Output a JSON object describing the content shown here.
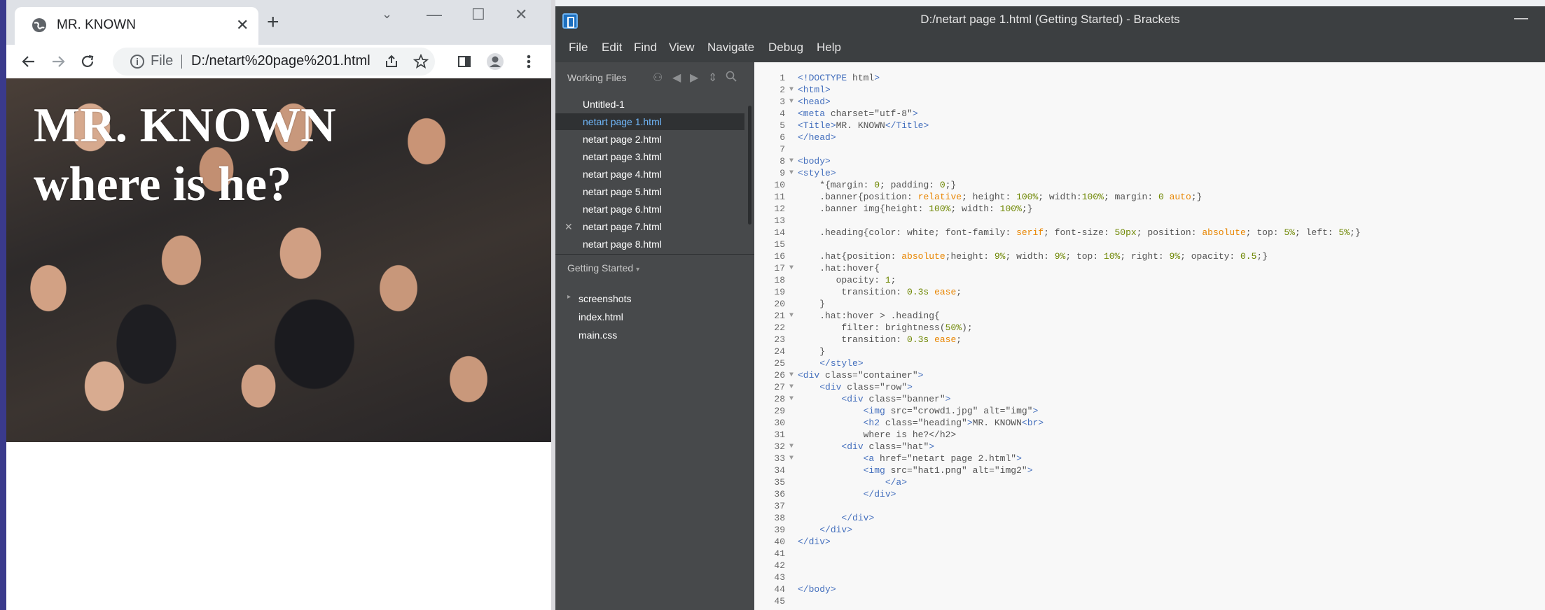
{
  "chrome": {
    "tab_title": "MR. KNOWN",
    "omnibox_file": "File",
    "url": "D:/netart%20page%201.html",
    "page_heading_line1": "MR. KNOWN",
    "page_heading_line2": "where is he?"
  },
  "brackets": {
    "title": "D:/netart page 1.html (Getting Started) - Brackets",
    "menu": [
      "File",
      "Edit",
      "Find",
      "View",
      "Navigate",
      "Debug",
      "Help"
    ],
    "working_files_label": "Working Files",
    "working_files": [
      "Untitled-1",
      "netart page 1.html",
      "netart page 2.html",
      "netart page 3.html",
      "netart page 4.html",
      "netart page 5.html",
      "netart page 6.html",
      "netart page 7.html",
      "netart page 8.html"
    ],
    "active_file_index": 1,
    "project_label": "Getting Started",
    "project_tree": [
      "screenshots",
      "index.html",
      "main.css"
    ],
    "code_lines": [
      "<!DOCTYPE html>",
      "<html>",
      "<head>",
      "<meta charset=\"utf-8\">",
      "<Title>MR. KNOWN</Title>",
      "</head>",
      "",
      "<body>",
      "<style>",
      "    *{margin: 0; padding: 0;}",
      "    .banner{position: relative; height: 100%; width:100%; margin: 0 auto;}",
      "    .banner img{height: 100%; width: 100%;}",
      "",
      "    .heading{color: white; font-family: serif; font-size: 50px; position: absolute; top: 5%; left: 5%;}",
      "",
      "    .hat{position: absolute;height: 9%; width: 9%; top: 10%; right: 9%; opacity: 0.5;}",
      "    .hat:hover{",
      "       opacity: 1;",
      "        transition: 0.3s ease;",
      "    }",
      "    .hat:hover > .heading{",
      "        filter: brightness(50%);",
      "        transition: 0.3s ease;",
      "    }",
      "    </style>",
      "<div class=\"container\">",
      "    <div class=\"row\">",
      "        <div class=\"banner\">",
      "            <img src=\"crowd1.jpg\" alt=\"img\">",
      "            <h2 class=\"heading\">MR. KNOWN<br>",
      "            where is he?</h2>",
      "        <div class=\"hat\">",
      "            <a href=\"netart page 2.html\">",
      "            <img src=\"hat1.png\" alt=\"img2\">",
      "                </a>",
      "            </div>",
      "",
      "        </div>",
      "    </div>",
      "</div>",
      "",
      "",
      "",
      "</body>",
      ""
    ],
    "fold_lines": [
      2,
      3,
      8,
      9,
      17,
      21,
      26,
      27,
      28,
      32,
      33
    ]
  }
}
